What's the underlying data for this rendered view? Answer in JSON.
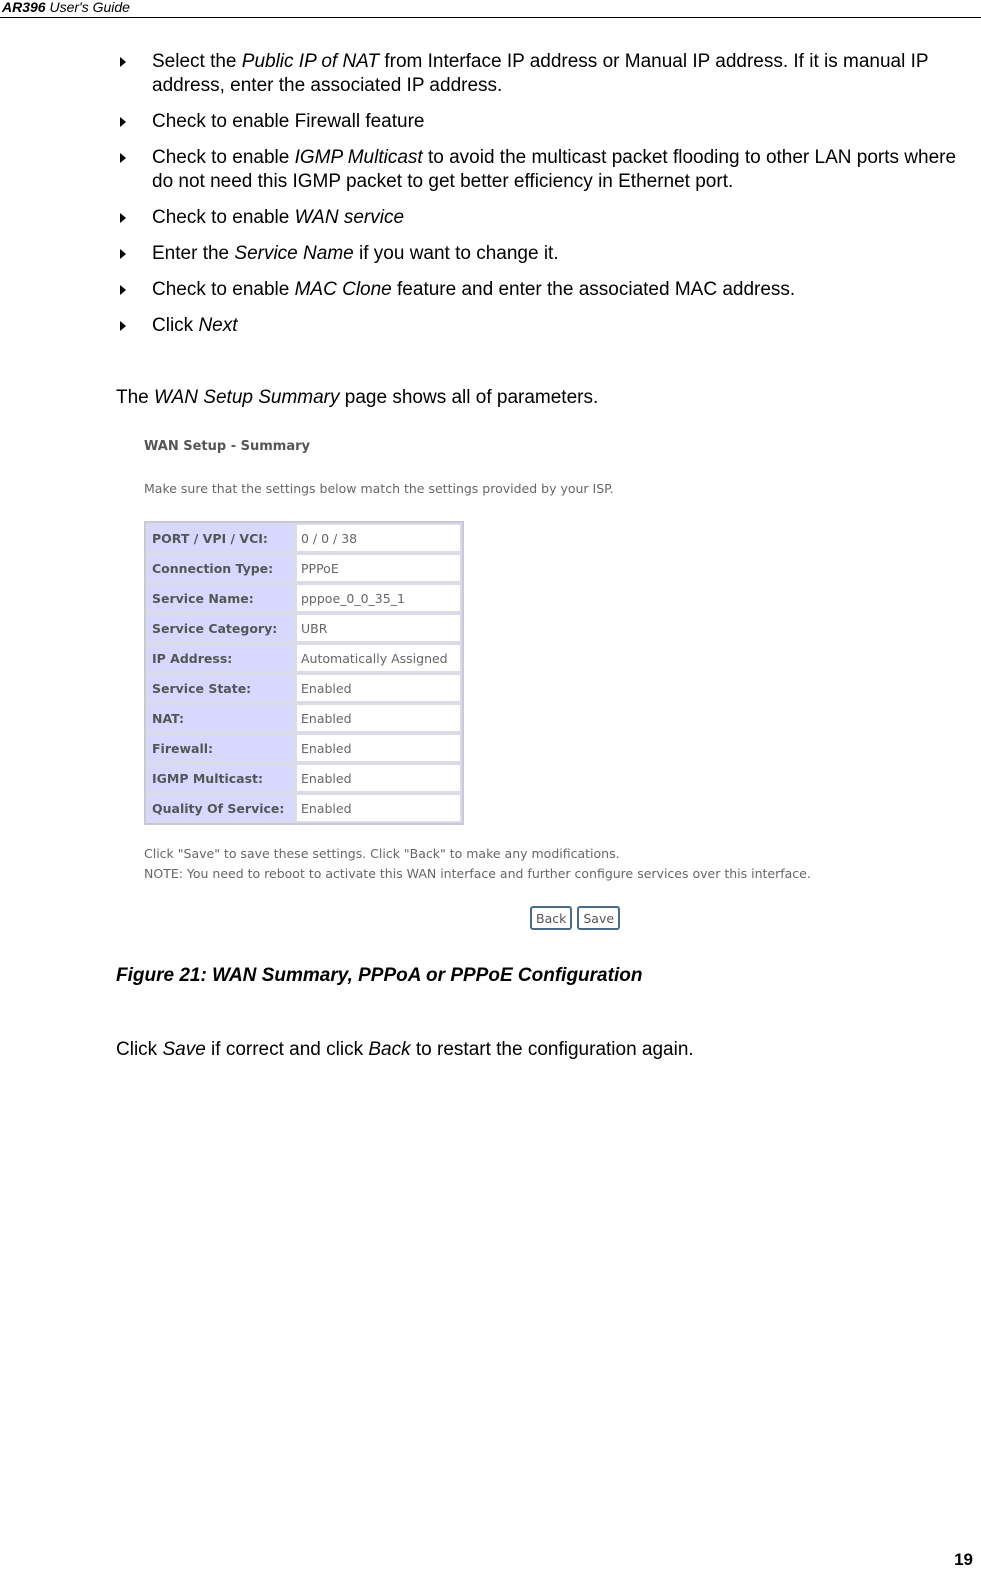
{
  "header": {
    "product": "AR396",
    "guide": " User's Guide"
  },
  "bullets": [
    {
      "parts": [
        {
          "t": "Select the "
        },
        {
          "t": "Public IP of NAT",
          "i": true
        },
        {
          "t": " from Interface IP address or Manual IP address. If it is manual IP address, enter the associated IP address."
        }
      ]
    },
    {
      "parts": [
        {
          "t": "Check to enable Firewall feature"
        }
      ]
    },
    {
      "parts": [
        {
          "t": "Check to enable "
        },
        {
          "t": "IGMP Multicast",
          "i": true
        },
        {
          "t": " to avoid the multicast packet flooding to other LAN ports where do not need this IGMP packet to get better efficiency in Ethernet port."
        }
      ]
    },
    {
      "parts": [
        {
          "t": "Check to enable "
        },
        {
          "t": "WAN service",
          "i": true
        }
      ]
    },
    {
      "parts": [
        {
          "t": "Enter the "
        },
        {
          "t": "Service Name",
          "i": true
        },
        {
          "t": " if you want to change it."
        }
      ]
    },
    {
      "parts": [
        {
          "t": "Check to enable "
        },
        {
          "t": "MAC Clone",
          "i": true
        },
        {
          "t": " feature and enter the associated MAC address."
        }
      ]
    },
    {
      "parts": [
        {
          "t": "Click "
        },
        {
          "t": "Next",
          "i": true
        }
      ]
    }
  ],
  "intro": {
    "pre": "The ",
    "em": "WAN Setup Summary",
    "post": " page shows all of parameters."
  },
  "screenshot": {
    "title": "WAN Setup - Summary",
    "intro": "Make sure that the settings below match the settings provided by your ISP.",
    "rows": [
      {
        "label": "PORT / VPI / VCI:",
        "value": "0 / 0 / 38"
      },
      {
        "label": "Connection Type:",
        "value": "PPPoE"
      },
      {
        "label": "Service Name:",
        "value": "pppoe_0_0_35_1"
      },
      {
        "label": "Service Category:",
        "value": "UBR"
      },
      {
        "label": "IP Address:",
        "value": "Automatically Assigned"
      },
      {
        "label": "Service State:",
        "value": "Enabled"
      },
      {
        "label": "NAT:",
        "value": "Enabled"
      },
      {
        "label": "Firewall:",
        "value": "Enabled"
      },
      {
        "label": "IGMP Multicast:",
        "value": "Enabled"
      },
      {
        "label": "Quality Of Service:",
        "value": "Enabled"
      }
    ],
    "note1": "Click \"Save\" to save these settings. Click \"Back\" to make any modifications.",
    "note2": "NOTE: You need to reboot to activate this WAN interface and further configure services over this interface.",
    "back_label": "Back",
    "save_label": "Save"
  },
  "caption": "Figure 21: WAN Summary, PPPoA or PPPoE Configuration",
  "closing": {
    "pre": "Click ",
    "em1": "Save",
    "mid": " if correct and click ",
    "em2": "Back",
    "post": " to restart the configuration again."
  },
  "page_number": "19"
}
